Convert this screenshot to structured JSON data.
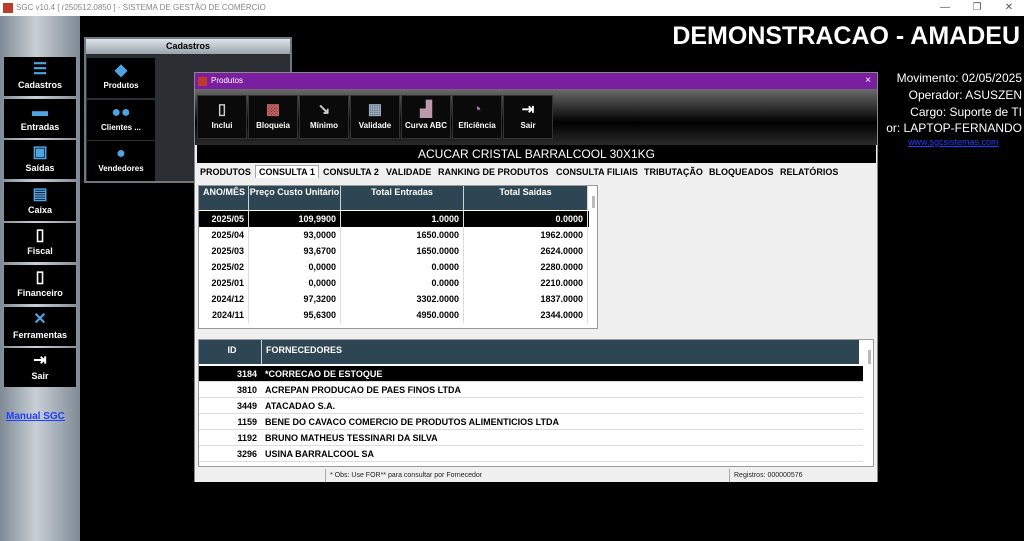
{
  "titlebar": {
    "title": "SGC v10.4 [ r250512.0850 ] - SISTEMA DE GESTÃO DE COMÉRCIO",
    "minimize": "—",
    "maximize": "❐",
    "close": "✕"
  },
  "sidebar": {
    "items": [
      {
        "label": "Cadastros",
        "icon": "stack-icon"
      },
      {
        "label": "Entradas",
        "icon": "truck-icon"
      },
      {
        "label": "Saídas",
        "icon": "cart-icon"
      },
      {
        "label": "Caixa",
        "icon": "register-icon"
      },
      {
        "label": "Fiscal",
        "icon": "document-icon"
      },
      {
        "label": "Financeiro",
        "icon": "finance-icon"
      },
      {
        "label": "Ferramentas",
        "icon": "tools-icon"
      },
      {
        "label": "Sair",
        "icon": "exit-icon"
      }
    ],
    "manual_link": "Manual SGC"
  },
  "cadastros_panel": {
    "title": "Cadastros",
    "items": [
      {
        "label": "Produtos",
        "icon": "box-icon"
      },
      {
        "label": "Clientes ...",
        "icon": "people-icon"
      },
      {
        "label": "Vendedores",
        "icon": "person-icon"
      }
    ]
  },
  "header": {
    "company": "DEMONSTRACAO - AMADEU",
    "movimento": "Movimento: 02/05/2025",
    "operador": "Operador: ASUSZEN",
    "cargo": "Cargo: Suporte de TI",
    "computador": "or: LAPTOP-FERNANDO",
    "site": "www.sgcsistemas.com"
  },
  "window": {
    "title": "Produtos",
    "close": "×",
    "toolbar": [
      {
        "label": "Inclui",
        "icon": "add-doc-icon"
      },
      {
        "label": "Bloqueia",
        "icon": "block-icon"
      },
      {
        "label": "Mínimo",
        "icon": "minimum-icon"
      },
      {
        "label": "Validade",
        "icon": "calendar-icon"
      },
      {
        "label": "Curva ABC",
        "icon": "abc-curve-icon"
      },
      {
        "label": "Eficiência",
        "icon": "efficiency-icon"
      },
      {
        "label": "Sair",
        "icon": "exit-icon"
      }
    ],
    "product_name": "ACUCAR CRISTAL BARRALCOOL  30X1KG",
    "tabs": [
      "PRODUTOS",
      "CONSULTA 1",
      "CONSULTA 2",
      "VALIDADE",
      "RANKING DE PRODUTOS",
      "CONSULTA FILIAIS",
      "TRIBUTAÇÃO",
      "BLOQUEADOS",
      "RELATÓRIOS"
    ],
    "active_tab": "CONSULTA 1",
    "consulta_table": {
      "headers": [
        "ANO/MÊS",
        "Preço Custo Unitário",
        "Total Entradas",
        "Total Saídas"
      ],
      "rows": [
        [
          "2025/05",
          "109,9900",
          "1.0000",
          "0.0000"
        ],
        [
          "2025/04",
          "93,0000",
          "1650.0000",
          "1962.0000"
        ],
        [
          "2025/03",
          "93,6700",
          "1650.0000",
          "2624.0000"
        ],
        [
          "2025/02",
          "0,0000",
          "0.0000",
          "2280.0000"
        ],
        [
          "2025/01",
          "0,0000",
          "0.0000",
          "2210.0000"
        ],
        [
          "2024/12",
          "97,3200",
          "3302.0000",
          "1837.0000"
        ],
        [
          "2024/11",
          "95,6300",
          "4950.0000",
          "2344.0000"
        ]
      ]
    },
    "fornecedores_table": {
      "headers": [
        "ID",
        "FORNECEDORES"
      ],
      "rows": [
        [
          "3184",
          "*CORRECAO DE ESTOQUE"
        ],
        [
          "3810",
          "ACREPAN PRODUCAO DE PAES  FINOS LTDA"
        ],
        [
          "3449",
          "ATACADAO S.A."
        ],
        [
          "1159",
          "BENE DO CAVACO COMERCIO DE PRODUTOS ALIMENTICIOS LTDA"
        ],
        [
          "1192",
          "BRUNO MATHEUS TESSINARI DA SILVA"
        ],
        [
          "3296",
          "USINA BARRALCOOL  SA"
        ]
      ]
    },
    "status": {
      "obs": "* Obs: Use FOR** para consultar por Fornecedor",
      "registros": "Registros: 000000576"
    }
  }
}
